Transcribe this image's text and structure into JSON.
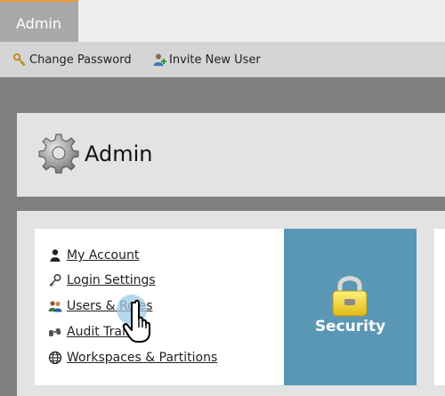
{
  "tabs": {
    "admin_label": "Admin"
  },
  "toolbar": {
    "change_password": {
      "label": "Change Password",
      "icon": "key-icon"
    },
    "invite_new_user": {
      "label": "Invite New User",
      "icon": "user-add-icon"
    }
  },
  "header": {
    "title": "Admin",
    "icon": "gear-icon"
  },
  "admin_links": [
    {
      "label": "My Account",
      "icon": "user-icon"
    },
    {
      "label": "Login Settings",
      "icon": "key-icon"
    },
    {
      "label": "Users & Roles",
      "icon": "users-icon"
    },
    {
      "label": "Audit Trail",
      "icon": "binoculars-icon"
    },
    {
      "label": "Workspaces & Partitions",
      "icon": "globe-icon"
    }
  ],
  "security_tile": {
    "label": "Security",
    "icon": "padlock-icon",
    "color": "#5a97b5"
  },
  "colors": {
    "tab_accent": "#f29a38",
    "tab_bg": "#a9a9ab",
    "tile_bg": "#5a97b5"
  }
}
